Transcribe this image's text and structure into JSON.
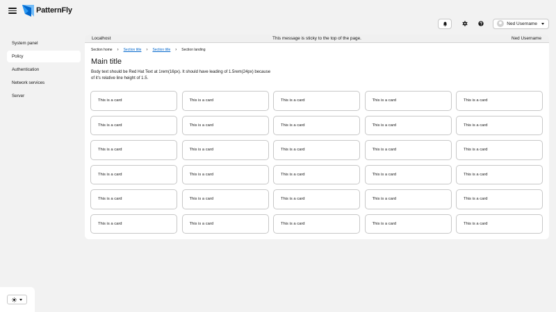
{
  "masthead": {
    "brand": "PatternFly",
    "user_name": "Ned Username"
  },
  "icons": {
    "menu": "hamburger-menu-icon",
    "logo": "patternfly-logo",
    "notifications": "bell-icon",
    "settings": "gear-icon",
    "help": "question-circle-icon",
    "avatar": "user-avatar",
    "theme": "sun-icon"
  },
  "sidebar": {
    "items": [
      {
        "label": "System panel",
        "active": false
      },
      {
        "label": "Policy",
        "active": true
      },
      {
        "label": "Authentication",
        "active": false
      },
      {
        "label": "Network services",
        "active": false
      },
      {
        "label": "Server",
        "active": false
      }
    ]
  },
  "banner": {
    "left": "Localhost",
    "center": "This message is sticky to the top of the page.",
    "right": "Ned Username"
  },
  "breadcrumb": [
    {
      "label": "Section home",
      "link": false
    },
    {
      "label": "Section title",
      "link": true
    },
    {
      "label": "Section title",
      "link": true
    },
    {
      "label": "Section landing",
      "link": false
    }
  ],
  "page": {
    "title": "Main title",
    "body": "Body text should be Red Hat Text at 1rem(16px). It should have leading of 1.5rem(24px) because of it's relative line height of 1.5."
  },
  "cards": [
    "This is a card",
    "This is a card",
    "This is a card",
    "This is a card",
    "This is a card",
    "This is a card",
    "This is a card",
    "This is a card",
    "This is a card",
    "This is a card",
    "This is a card",
    "This is a card",
    "This is a card",
    "This is a card",
    "This is a card",
    "This is a card",
    "This is a card",
    "This is a card",
    "This is a card",
    "This is a card",
    "This is a card",
    "This is a card",
    "This is a card",
    "This is a card",
    "This is a card",
    "This is a card",
    "This is a card",
    "This is a card",
    "This is a card",
    "This is a card"
  ],
  "colors": {
    "link": "#0066cc",
    "logo_blue": "#0066cc",
    "logo_light": "#73bcf7",
    "page_bg": "#f2f2f2"
  }
}
